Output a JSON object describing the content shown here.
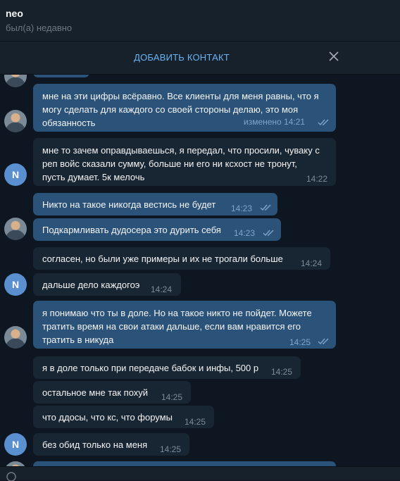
{
  "header": {
    "name": "neo",
    "status": "был(а) недавно"
  },
  "add_contact": {
    "label": "ДОБАВИТЬ КОНТАКТ"
  },
  "avatars": {
    "n_letter": "N"
  },
  "messages": [
    {
      "dir": "out",
      "lines": [
        "мне на эти цифры всёравно. Все клиенты для меня равны, что я",
        "могу сделать для каждого со своей стороны делаю, это моя",
        "обязанность"
      ],
      "time": "изменено 14:21",
      "read": true
    },
    {
      "dir": "in",
      "lines": [
        "мне то зачем оправдываешься, я передал, что просили, чуваку с",
        "реп войс сказали сумму, больше ни его ни ксхост не тронут,",
        "пусть думает. 5к мелочь"
      ],
      "time": "14:22"
    },
    {
      "dir": "out",
      "lines": [
        "Никто на такое никогда вестись не будет"
      ],
      "time": "14:23",
      "read": true
    },
    {
      "dir": "out",
      "lines": [
        "Подкармливать дудосера это дурить себя"
      ],
      "time": "14:23",
      "read": true
    },
    {
      "dir": "in",
      "lines": [
        "согласен, но были уже примеры и их не трогали больше"
      ],
      "time": "14:24"
    },
    {
      "dir": "in",
      "lines": [
        "дальше дело каждогоэ"
      ],
      "time": "14:24"
    },
    {
      "dir": "out",
      "lines": [
        "я понимаю что ты в доле. Но на такое никто не пойдет. Можете",
        "тратить время на свои атаки дальше, если вам нравится его",
        "тратить в никуда"
      ],
      "time": "14:25",
      "read": true
    },
    {
      "dir": "in",
      "lines": [
        "я в доле только при передаче бабок и инфы, 500 р"
      ],
      "time": "14:25"
    },
    {
      "dir": "in",
      "lines": [
        "остальное мне так похуй"
      ],
      "time": "14:25"
    },
    {
      "dir": "in",
      "lines": [
        "что ддосы, что кс, что форумы"
      ],
      "time": "14:25"
    },
    {
      "dir": "in",
      "lines": [
        "без обид только на меня"
      ],
      "time": "14:25"
    }
  ],
  "icons": {
    "close": "close-icon",
    "check": "double-check-icon",
    "attach": "paperclip-icon"
  },
  "colors": {
    "background": "#0e1621",
    "outgoing": "#2b5278",
    "incoming": "#182533",
    "accent": "#6ab3f3"
  }
}
